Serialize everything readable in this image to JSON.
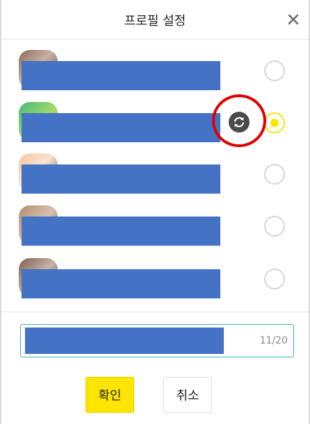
{
  "dialog": {
    "title": "프로필 설정",
    "close_icon": "close-icon"
  },
  "profiles": [
    {
      "selected": false
    },
    {
      "selected": true,
      "action_icon": "refresh-icon"
    },
    {
      "selected": false
    },
    {
      "selected": false
    },
    {
      "selected": false
    }
  ],
  "nickname_input": {
    "char_count": "11/20"
  },
  "buttons": {
    "confirm_label": "확인",
    "cancel_label": "취소"
  },
  "colors": {
    "accent_yellow": "#fee500",
    "radio_selected": "#f7e600",
    "input_border": "#35b5b5",
    "annotation_red": "#e00000"
  }
}
